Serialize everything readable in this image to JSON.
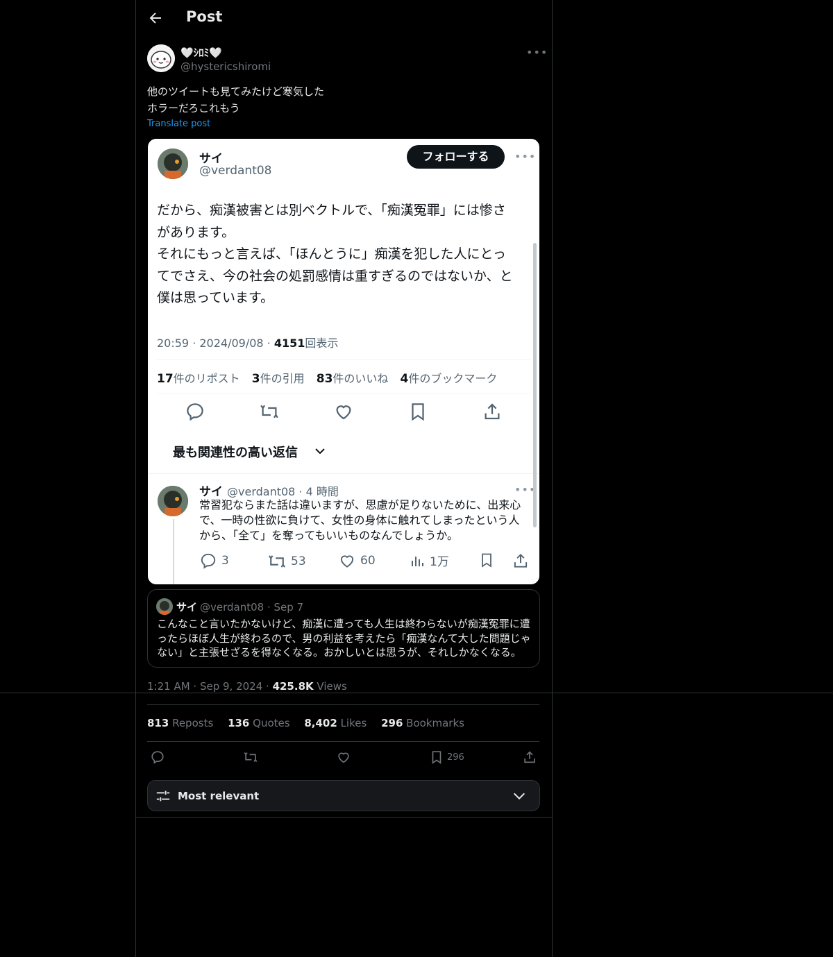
{
  "header": {
    "title": "Post"
  },
  "author": {
    "display_name": "🤍ｼﾛﾐ🤍",
    "handle": "@hystericshiromi"
  },
  "post": {
    "lines": [
      "他のツイートも見てみたけど寒気した",
      "ホラーだろこれもう"
    ],
    "translate_label": "Translate post"
  },
  "embedded_screenshot": {
    "name": "サイ",
    "handle": "@verdant08",
    "follow_label": "フォローする",
    "body_lines": [
      "だから、痴漢被害とは別ベクトルで、「痴漢冤罪」には惨さ",
      "があります。",
      "それにもっと言えば、「ほんとうに」痴漢を犯した人にとっ",
      "てでさえ、今の社会の処罰感情は重すぎるのではないか、と",
      "僕は思っています。"
    ],
    "meta_time": "20:59 · 2024/09/08 · ",
    "meta_views_num": "4151",
    "meta_views_label": "回表示",
    "stats": [
      {
        "num": "17",
        "label": "件のリポスト"
      },
      {
        "num": "3",
        "label": "件の引用"
      },
      {
        "num": "83",
        "label": "件のいいね"
      },
      {
        "num": "4",
        "label": "件のブックマーク"
      }
    ],
    "relevant_label": "最も関連性の高い返信",
    "reply": {
      "name": "サイ",
      "handle_time": "@verdant08 · 4 時間",
      "lines": [
        "常習犯ならまた話は違いますが、思慮が足りないために、出来心",
        "で、一時の性欲に負けて、女性の身体に触れてしまったという人",
        "から、「全て」を奪ってもいいものなんでしょうか。"
      ],
      "replies": "3",
      "reposts": "53",
      "likes": "60",
      "views": "1万"
    }
  },
  "quote": {
    "name": "サイ",
    "handle": "@verdant08",
    "date": "· Sep 7",
    "lines": [
      "こんなこと言いたかないけど、痴漢に遭っても人生は終わらないが痴漢冤罪に遭",
      "ったらほぼ人生が終わるので、男の利益を考えたら「痴漢なんて大した問題じゃ",
      "ない」と主張せざるを得なくなる。おかしいとは思うが、それしかなくなる。"
    ]
  },
  "timestamp": {
    "time": "1:21 AM · Sep 9, 2024 · ",
    "views_num": "425.8K",
    "views_label": " Views"
  },
  "stats": {
    "reposts_num": "813",
    "reposts_label": " Reposts",
    "quotes_num": "136",
    "quotes_label": " Quotes",
    "likes_num": "8,402",
    "likes_label": " Likes",
    "bookmarks_num": "296",
    "bookmarks_label": " Bookmarks"
  },
  "actions": {
    "bookmark_count": "296"
  },
  "sort": {
    "label": "Most relevant"
  },
  "colors": {
    "background": "#000000",
    "text": "#e7e9ea",
    "muted": "#71767b",
    "link": "#1d9bf0",
    "border": "#2f3336"
  },
  "icons": [
    "back-arrow-icon",
    "more-icon",
    "reply-icon",
    "repost-icon",
    "like-icon",
    "bookmark-icon",
    "share-icon",
    "views-icon",
    "sliders-icon",
    "chevron-down-icon"
  ]
}
